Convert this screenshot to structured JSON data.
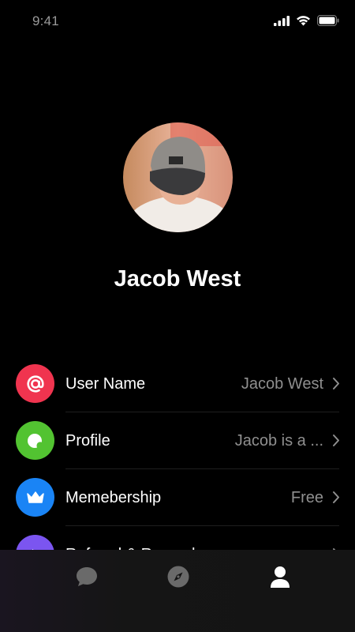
{
  "status_bar": {
    "time": "9:41"
  },
  "profile": {
    "name": "Jacob West"
  },
  "settings": [
    {
      "label": "User Name",
      "value": "Jacob West",
      "icon": "at-icon",
      "color": "#f0344f"
    },
    {
      "label": "Profile",
      "value": "Jacob is a ...",
      "icon": "profile-dot-icon",
      "color": "#52c331"
    },
    {
      "label": "Memebership",
      "value": "Free",
      "icon": "crown-icon",
      "color": "#1a84f5"
    },
    {
      "label": "Referral & Rewards",
      "value": "",
      "icon": "play-icon",
      "color": "#7b55f0"
    }
  ],
  "tab_bar": {
    "tabs": [
      {
        "icon": "chat-bubble-icon",
        "active": false
      },
      {
        "icon": "compass-icon",
        "active": false
      },
      {
        "icon": "user-icon",
        "active": true
      }
    ]
  },
  "colors": {
    "background": "#000000",
    "muted_text": "#8f8f8f",
    "active_tab": "#ffffff",
    "inactive_tab": "#6a6a6a"
  }
}
